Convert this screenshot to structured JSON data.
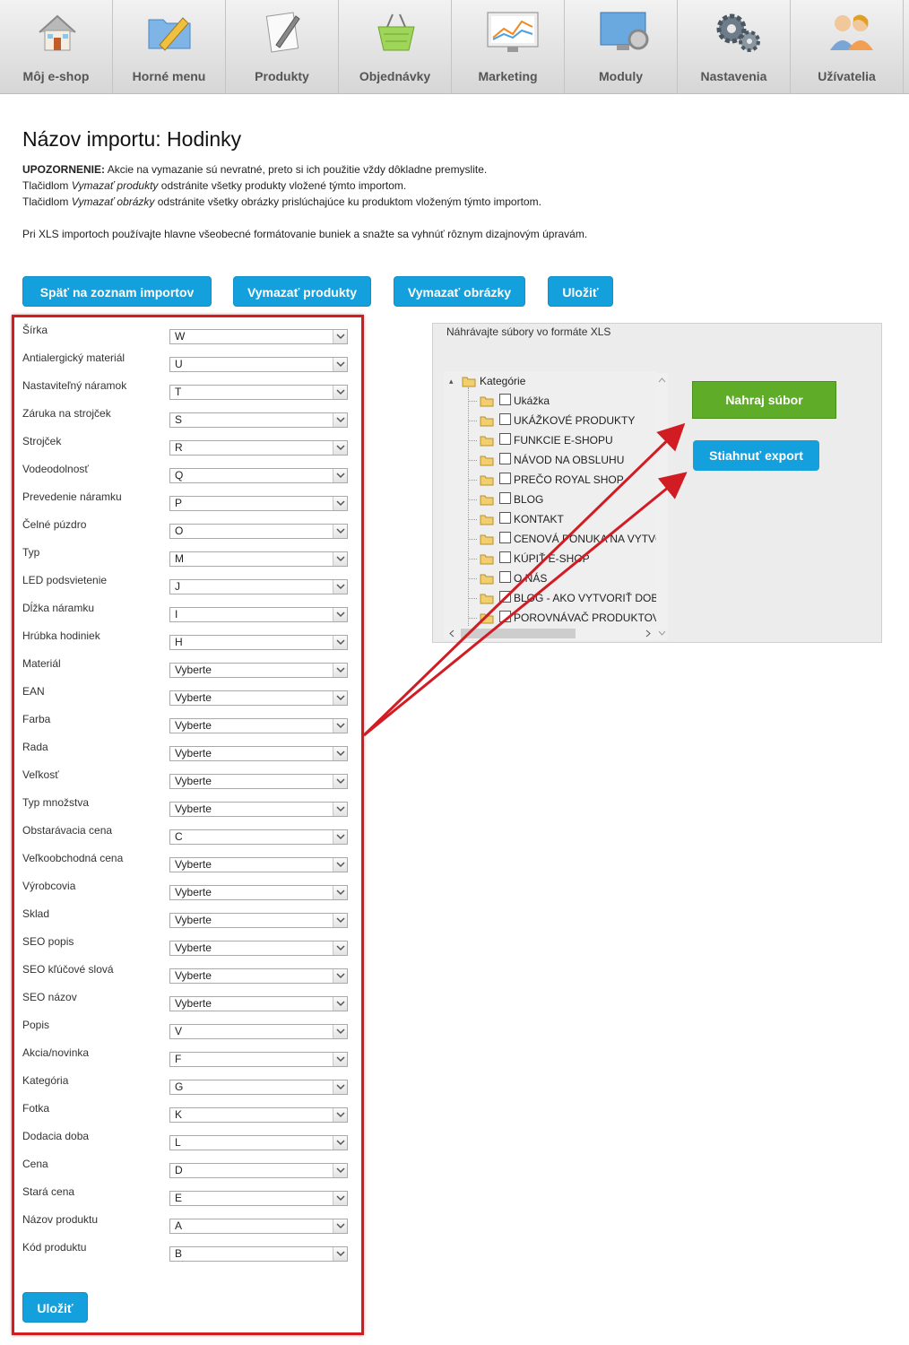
{
  "nav": {
    "items": [
      {
        "label": "Môj e-shop",
        "icon": "home-icon"
      },
      {
        "label": "Horné menu",
        "icon": "folder-pencil-icon"
      },
      {
        "label": "Produkty",
        "icon": "document-pencil-icon"
      },
      {
        "label": "Objednávky",
        "icon": "basket-icon"
      },
      {
        "label": "Marketing",
        "icon": "monitor-chart-icon"
      },
      {
        "label": "Moduly",
        "icon": "monitor-gear-icon"
      },
      {
        "label": "Nastavenia",
        "icon": "gears-icon"
      },
      {
        "label": "Užívatelia",
        "icon": "users-icon"
      }
    ]
  },
  "page": {
    "title": "Názov importu: Hodinky",
    "warning_label": "UPOZORNENIE:",
    "warning_text": " Akcie na vymazanie sú nevratné, preto si ich použitie vždy dôkladne premyslite.",
    "line2_pre": "Tlačidlom ",
    "line2_em": "Vymazať produkty",
    "line2_post": " odstránite všetky produkty vložené týmto importom.",
    "line3_pre": "Tlačidlom ",
    "line3_em": "Vymazať obrázky",
    "line3_post": " odstránite všetky obrázky prislúchajúce ku produktom vloženým týmto importom.",
    "line4": "Pri XLS importoch používajte hlavne všeobecné formátovanie buniek a snažte sa vyhnúť rôznym dizajnovým úpravám."
  },
  "actions": {
    "back": "Späť na zoznam importov",
    "delete_products": "Vymazať produkty",
    "delete_images": "Vymazať obrázky",
    "save": "Uložiť"
  },
  "fields": [
    {
      "label": "Šírka",
      "value": "W"
    },
    {
      "label": "Antialergický materiál",
      "value": "U"
    },
    {
      "label": "Nastaviteľný náramok",
      "value": "T"
    },
    {
      "label": "Záruka na strojček",
      "value": "S"
    },
    {
      "label": "Strojček",
      "value": "R"
    },
    {
      "label": "Vodeodolnosť",
      "value": "Q"
    },
    {
      "label": "Prevedenie náramku",
      "value": "P"
    },
    {
      "label": "Čelné púzdro",
      "value": "O"
    },
    {
      "label": "Typ",
      "value": "M"
    },
    {
      "label": "LED podsvietenie",
      "value": "J"
    },
    {
      "label": "Dĺžka náramku",
      "value": "I"
    },
    {
      "label": "Hrúbka hodiniek",
      "value": "H"
    },
    {
      "label": "Materiál",
      "value": "Vyberte"
    },
    {
      "label": "EAN",
      "value": "Vyberte"
    },
    {
      "label": "Farba",
      "value": "Vyberte"
    },
    {
      "label": "Rada",
      "value": "Vyberte"
    },
    {
      "label": "Veľkosť",
      "value": "Vyberte"
    },
    {
      "label": "Typ množstva",
      "value": "Vyberte"
    },
    {
      "label": "Obstarávacia cena",
      "value": "C"
    },
    {
      "label": "Veľkoobchodná cena",
      "value": "Vyberte"
    },
    {
      "label": "Výrobcovia",
      "value": "Vyberte"
    },
    {
      "label": "Sklad",
      "value": "Vyberte"
    },
    {
      "label": "SEO popis",
      "value": "Vyberte"
    },
    {
      "label": "SEO kľúčové slová",
      "value": "Vyberte"
    },
    {
      "label": "SEO názov",
      "value": "Vyberte"
    },
    {
      "label": "Popis",
      "value": "V"
    },
    {
      "label": "Akcia/novinka",
      "value": "F"
    },
    {
      "label": "Kategória",
      "value": "G"
    },
    {
      "label": "Fotka",
      "value": "K"
    },
    {
      "label": "Dodacia doba",
      "value": "L"
    },
    {
      "label": "Cena",
      "value": "D"
    },
    {
      "label": "Stará cena",
      "value": "E"
    },
    {
      "label": "Názov produktu",
      "value": "A"
    },
    {
      "label": "Kód produktu",
      "value": "B"
    }
  ],
  "bottom_save": "Uložiť",
  "upload_panel": {
    "note": "Náhrávajte súbory vo formáte XLS",
    "root": "Kategórie",
    "categories": [
      "Ukážka",
      "UKÁŽKOVÉ PRODUKTY",
      "FUNKCIE E-SHOPU",
      "NÁVOD NA OBSLUHU",
      "PREČO ROYAL SHOP",
      "BLOG",
      "KONTAKT",
      "CENOVÁ PONUKA NA VYTVC",
      "KÚPIŤ E-SHOP",
      "O NÁS",
      "BLOG - AKO VYTVORIŤ DOB",
      "POROVNÁVAČ PRODUKTOV"
    ],
    "upload_button": "Nahraj súbor",
    "export_button": "Stiahnuť export"
  },
  "colors": {
    "accent": "#13a0dc",
    "upload": "#5fac28",
    "highlight": "#d11c24"
  }
}
